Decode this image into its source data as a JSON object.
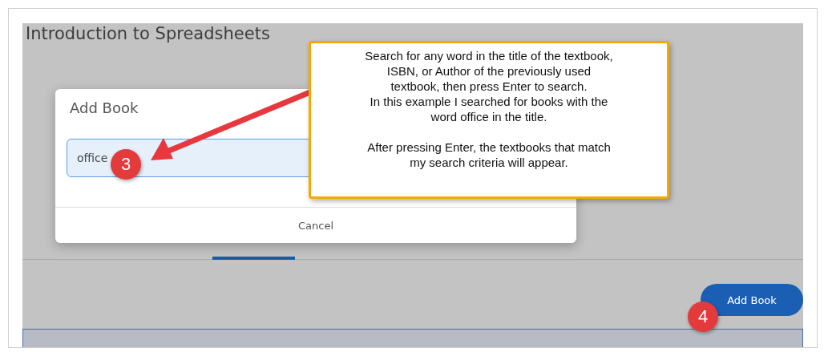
{
  "page": {
    "title": "Introduction to Spreadsheets"
  },
  "dialog": {
    "title": "Add Book",
    "search": {
      "value": "office"
    },
    "cancel": "Cancel"
  },
  "callout": {
    "paragraphs": [
      "Search for any word in the title of the textbook,\nISBN, or Author of the previously used\ntextbook, then press Enter to search.\nIn this example I searched for books with the\nword office in the title.",
      "After pressing Enter, the textbooks that match\nmy search criteria will appear."
    ]
  },
  "step_badges": [
    "3",
    "4"
  ],
  "add_book_button": "Add Book"
}
